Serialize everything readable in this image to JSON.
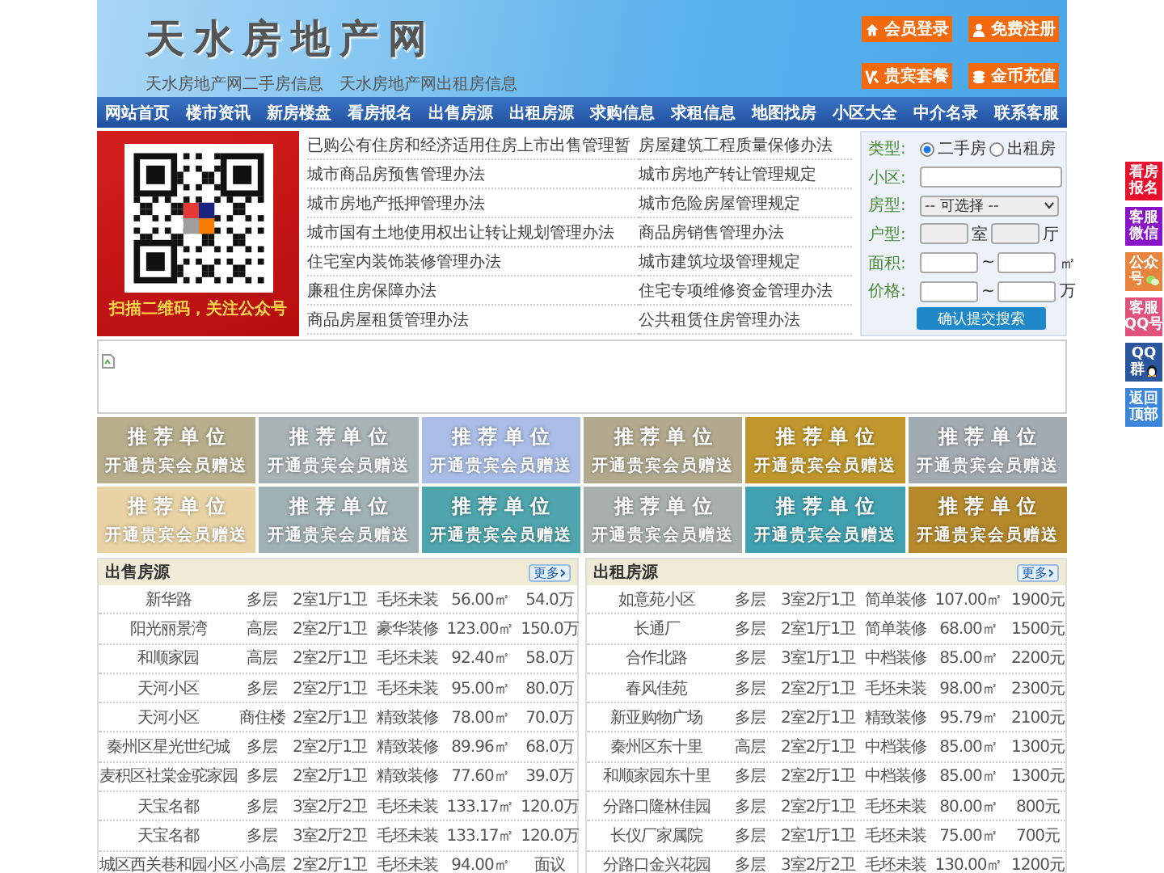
{
  "header": {
    "title": "天水房地产网",
    "subtitles": [
      "天水房地产网二手房信息",
      "天水房地产网出租房信息"
    ],
    "buttons": [
      {
        "label": "会员登录",
        "kind": "home"
      },
      {
        "label": "免费注册",
        "kind": "user"
      },
      {
        "label": "贵宾套餐",
        "kind": "vip"
      },
      {
        "label": "金币充值",
        "kind": "coins"
      }
    ]
  },
  "nav": [
    "网站首页",
    "楼市资讯",
    "新房楼盘",
    "看房报名",
    "出售房源",
    "出租房源",
    "求购信息",
    "求租信息",
    "地图找房",
    "小区大全",
    "中介名录",
    "联系客服"
  ],
  "qr": {
    "caption": "扫描二维码，关注公众号"
  },
  "links": [
    "已购公有住房和经济适用住房上市出售管理暂",
    "房屋建筑工程质量保修办法",
    "城市商品房预售管理办法",
    "城市房地产转让管理规定",
    "城市房地产抵押管理办法",
    "城市危险房屋管理规定",
    "城市国有土地使用权出让转让规划管理办法",
    "商品房销售管理办法",
    "住宅室内装饰装修管理办法",
    "城市建筑垃圾管理规定",
    "廉租住房保障办法",
    "住宅专项维修资金管理办法",
    "商品房屋租赁管理办法",
    "公共租赁住房管理办法"
  ],
  "search_form": {
    "type_label": "类型:",
    "options": [
      {
        "label": "二手房",
        "selected": true
      },
      {
        "label": "出租房",
        "selected": false
      }
    ],
    "fields": [
      {
        "label": "小区:",
        "kind": "text"
      },
      {
        "label": "房型:",
        "kind": "select",
        "value": "-- 可选择 --"
      },
      {
        "label": "户型:",
        "kind": "layout",
        "units": [
          "室",
          "厅"
        ]
      },
      {
        "label": "面积:",
        "kind": "range",
        "sep": "~",
        "unit": "㎡"
      },
      {
        "label": "价格:",
        "kind": "range",
        "sep": "~",
        "unit": "万"
      }
    ],
    "submit": "确认提交搜索"
  },
  "tiles": [
    {
      "title": "推 荐 单 位",
      "subtitle": "开通贵宾会员赠送",
      "color": "#b8ae8c"
    },
    {
      "title": "推 荐 单 位",
      "subtitle": "开通贵宾会员赠送",
      "color": "#a8b3b6"
    },
    {
      "title": "推 荐 单 位",
      "subtitle": "开通贵宾会员赠送",
      "color": "#a9bde6"
    },
    {
      "title": "推 荐 单 位",
      "subtitle": "开通贵宾会员赠送",
      "color": "#b2a98e"
    },
    {
      "title": "推 荐 单 位",
      "subtitle": "开通贵宾会员赠送",
      "color": "#c0972c"
    },
    {
      "title": "推 荐 单 位",
      "subtitle": "开通贵宾会员赠送",
      "color": "#a3abb2"
    },
    {
      "title": "推 荐 单 位",
      "subtitle": "开通贵宾会员赠送",
      "color": "#e9d3a4"
    },
    {
      "title": "推 荐 单 位",
      "subtitle": "开通贵宾会员赠送",
      "color": "#a0b1b4"
    },
    {
      "title": "推 荐 单 位",
      "subtitle": "开通贵宾会员赠送",
      "color": "#4ea5ad"
    },
    {
      "title": "推 荐 单 位",
      "subtitle": "开通贵宾会员赠送",
      "color": "#a9b0ab"
    },
    {
      "title": "推 荐 单 位",
      "subtitle": "开通贵宾会员赠送",
      "color": "#41a1b0"
    },
    {
      "title": "推 荐 单 位",
      "subtitle": "开通贵宾会员赠送",
      "color": "#b5892b"
    }
  ],
  "sale": {
    "title": "出售房源",
    "more": "更多",
    "rows": [
      [
        "新华路",
        "多层",
        "2室1厅1卫",
        "毛坯未装",
        "56.00㎡",
        "54.0万"
      ],
      [
        "阳光丽景湾",
        "高层",
        "2室2厅1卫",
        "豪华装修",
        "123.00㎡",
        "150.0万"
      ],
      [
        "和顺家园",
        "高层",
        "2室2厅1卫",
        "毛坯未装",
        "92.40㎡",
        "58.0万"
      ],
      [
        "天河小区",
        "多层",
        "2室2厅1卫",
        "毛坯未装",
        "95.00㎡",
        "80.0万"
      ],
      [
        "天河小区",
        "商住楼",
        "2室2厅1卫",
        "精致装修",
        "78.00㎡",
        "70.0万"
      ],
      [
        "秦州区星光世纪城",
        "多层",
        "2室2厅1卫",
        "精致装修",
        "89.96㎡",
        "68.0万"
      ],
      [
        "麦积区社棠金驼家园",
        "多层",
        "2室2厅1卫",
        "精致装修",
        "77.60㎡",
        "39.0万"
      ],
      [
        "天宝名都",
        "多层",
        "3室2厅2卫",
        "毛坯未装",
        "133.17㎡",
        "120.0万"
      ],
      [
        "天宝名都",
        "多层",
        "3室2厅2卫",
        "毛坯未装",
        "133.17㎡",
        "120.0万"
      ],
      [
        "城区西关巷和园小区",
        "小高层",
        "2室2厅1卫",
        "毛坯未装",
        "94.00㎡",
        "面议"
      ]
    ]
  },
  "rent": {
    "title": "出租房源",
    "more": "更多",
    "rows": [
      [
        "如意苑小区",
        "多层",
        "3室2厅1卫",
        "简单装修",
        "107.00㎡",
        "1900元"
      ],
      [
        "长通厂",
        "多层",
        "2室1厅1卫",
        "简单装修",
        "68.00㎡",
        "1500元"
      ],
      [
        "合作北路",
        "多层",
        "3室1厅1卫",
        "中档装修",
        "85.00㎡",
        "2200元"
      ],
      [
        "春风佳苑",
        "多层",
        "2室2厅1卫",
        "毛坯未装",
        "98.00㎡",
        "2300元"
      ],
      [
        "新亚购物广场",
        "多层",
        "2室2厅1卫",
        "精致装修",
        "95.79㎡",
        "2100元"
      ],
      [
        "秦州区东十里",
        "高层",
        "2室2厅1卫",
        "中档装修",
        "85.00㎡",
        "1300元"
      ],
      [
        "和顺家园东十里",
        "多层",
        "2室2厅1卫",
        "中档装修",
        "85.00㎡",
        "1300元"
      ],
      [
        "分路口隆林佳园",
        "多层",
        "2室2厅1卫",
        "毛坯未装",
        "80.00㎡",
        "800元"
      ],
      [
        "长仪厂家属院",
        "多层",
        "2室1厅1卫",
        "毛坯未装",
        "75.00㎡",
        "700元"
      ],
      [
        "分路口金兴花园",
        "多层",
        "3室2厅2卫",
        "毛坯未装",
        "130.00㎡",
        "1200元"
      ]
    ]
  },
  "side_buttons": [
    {
      "lines": [
        "看房",
        "报名"
      ],
      "color": "#e8112d"
    },
    {
      "lines": [
        "客服",
        "微信"
      ],
      "color": "#8a14c8"
    },
    {
      "lines": [
        "公众",
        "号"
      ],
      "color": "#e8843e",
      "kind": "chat"
    },
    {
      "lines": [
        "客服",
        "QQ号"
      ],
      "color": "#e2537c"
    },
    {
      "lines": [
        "QQ",
        "群"
      ],
      "color": "#2a569e",
      "kind": "penguin"
    },
    {
      "lines": [
        "返回",
        "顶部"
      ],
      "color": "#3b86d8"
    }
  ]
}
